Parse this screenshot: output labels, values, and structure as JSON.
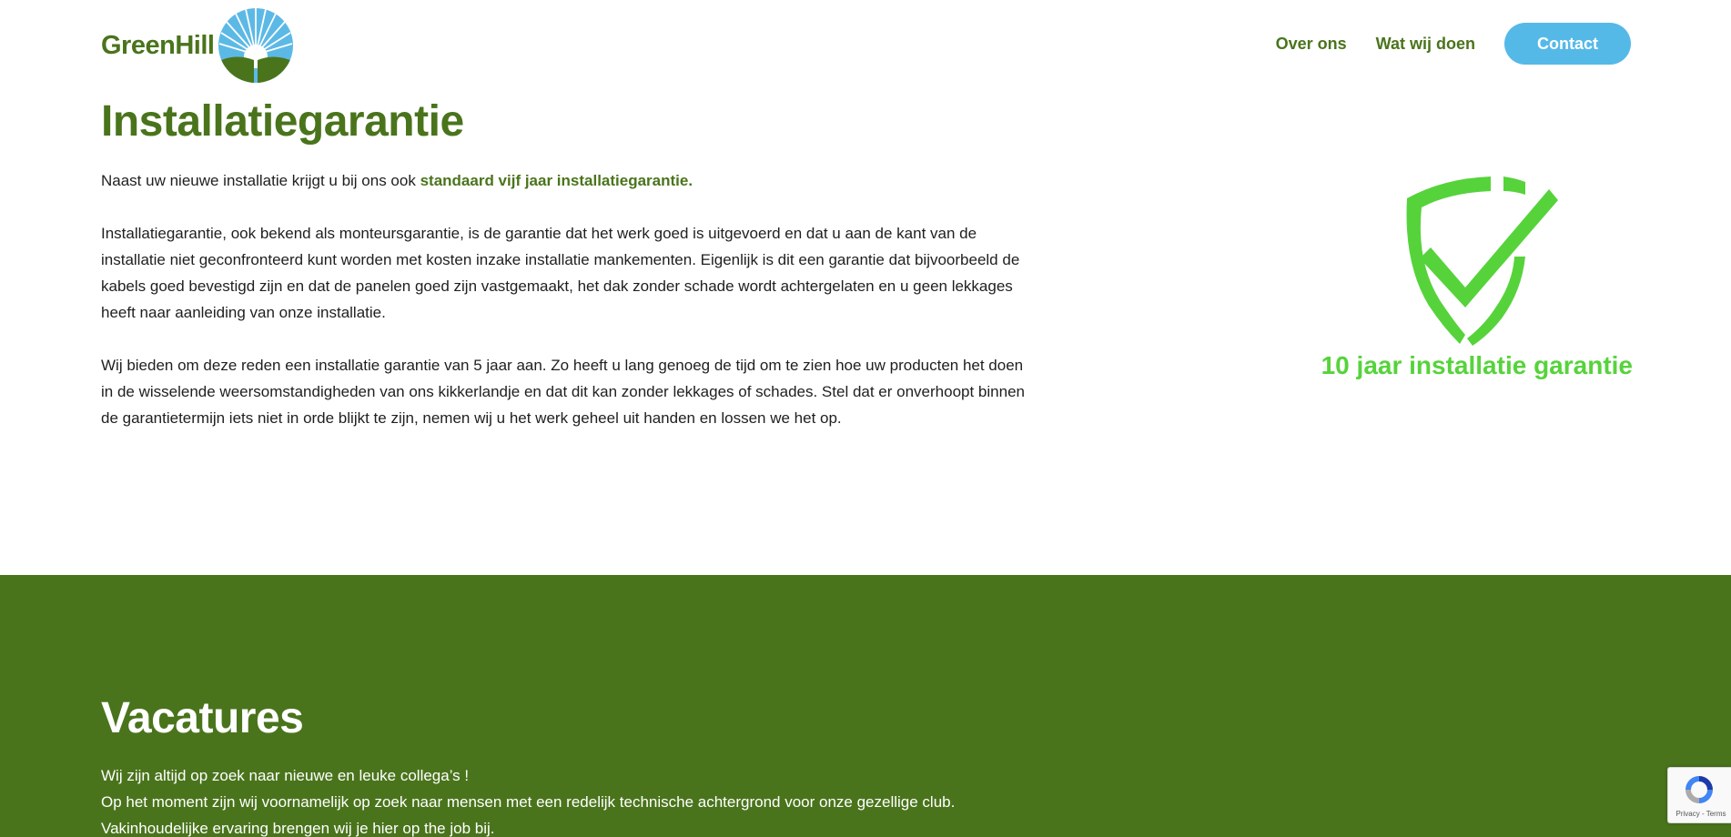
{
  "header": {
    "logo_text": "GreenHill",
    "nav": [
      {
        "label": "Over ons"
      },
      {
        "label": "Wat wij doen"
      }
    ],
    "contact_label": "Contact"
  },
  "main": {
    "title": "Installatiegarantie",
    "intro": "Naast uw nieuwe installatie krijgt u bij ons ook ",
    "intro_highlight": "standaard vijf jaar installatiegarantie.",
    "paragraph_2": "Installatiegarantie, ook bekend als monteursgarantie, is de garantie dat het werk goed is uitgevoerd en dat u aan de kant van de installatie niet geconfronteerd kunt worden met kosten inzake installatie mankementen. Eigenlijk is dit een garantie dat bijvoorbeeld de kabels goed bevestigd zijn en dat de panelen goed zijn vastgemaakt, het dak zonder schade wordt achtergelaten en u geen lekkages heeft naar aanleiding van onze installatie.",
    "paragraph_3": "Wij bieden om deze reden een installatie garantie van 5 jaar aan. Zo heeft u lang genoeg de tijd om te zien hoe uw producten het doen in de wisselende weersomstandigheden van ons kikkerlandje en dat dit kan zonder lekkages of schades. Stel dat er onverhoopt binnen de garantietermijn iets niet in orde blijkt te zijn, nemen wij u het werk geheel uit handen en lossen we het op.",
    "badge_caption": "10 jaar installatie garantie",
    "badge_icon": "shield-check-icon"
  },
  "vacatures": {
    "title": "Vacatures",
    "line_1": "Wij zijn altijd op zoek naar nieuwe en leuke collega’s !",
    "line_2": "Op het moment zijn wij voornamelijk op zoek naar mensen met een redelijk technische achtergrond voor onze gezellige club.",
    "line_3": "Vakinhoudelijke ervaring brengen wij je hier op the job bij."
  },
  "recaptcha": {
    "links": "Privacy - Terms"
  },
  "colors": {
    "brand_green": "#4a741c",
    "accent_blue": "#55b9e8",
    "badge_green": "#56d33b"
  }
}
